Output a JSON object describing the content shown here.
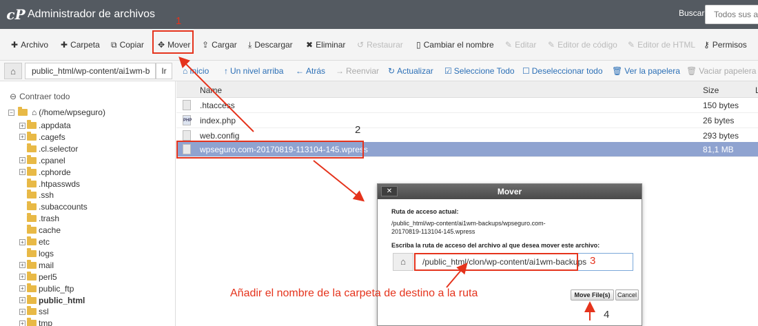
{
  "header": {
    "logo": "cP",
    "title": "Administrador de archivos",
    "search_label": "Buscar",
    "search_placeholder": "Todos sus archivos"
  },
  "toolbar": {
    "archivo": "Archivo",
    "carpeta": "Carpeta",
    "copiar": "Copiar",
    "mover": "Mover",
    "cargar": "Cargar",
    "descargar": "Descargar",
    "eliminar": "Eliminar",
    "restaurar": "Restaurar",
    "cambiar_nombre": "Cambiar el nombre",
    "editar": "Editar",
    "editor_codigo": "Editor de código",
    "editor_html": "Editor de HTML",
    "permisos": "Permisos"
  },
  "pathbar": {
    "path": "public_html/wp-content/ai1wm-b",
    "go": "Ir",
    "inicio": "Inicio",
    "up": "Un nivel arriba",
    "back": "Atrás",
    "forward": "Reenviar",
    "refresh": "Actualizar",
    "select_all": "Seleccione Todo",
    "deselect_all": "Deseleccionar todo",
    "trash": "Ver la papelera",
    "empty_trash": "Vaciar papelera"
  },
  "sidebar": {
    "collapse": "Contraer todo",
    "root": "(/home/wpseguro)",
    "items": [
      {
        "label": ".appdata"
      },
      {
        "label": ".cagefs"
      },
      {
        "label": ".cl.selector"
      },
      {
        "label": ".cpanel"
      },
      {
        "label": ".cphorde"
      },
      {
        "label": ".htpasswds"
      },
      {
        "label": ".ssh"
      },
      {
        "label": ".subaccounts"
      },
      {
        "label": ".trash"
      },
      {
        "label": "cache"
      },
      {
        "label": "etc"
      },
      {
        "label": "logs"
      },
      {
        "label": "mail"
      },
      {
        "label": "perl5"
      },
      {
        "label": "public_ftp"
      },
      {
        "label": "public_html"
      },
      {
        "label": "ssl"
      },
      {
        "label": "tmp"
      }
    ]
  },
  "filelist": {
    "col_name": "Name",
    "col_size": "Size",
    "col_extra": "L",
    "rows": [
      {
        "name": ".htaccess",
        "size": "150 bytes"
      },
      {
        "name": "index.php",
        "size": "26 bytes"
      },
      {
        "name": "web.config",
        "size": "293 bytes"
      },
      {
        "name": "wpseguro.com-20170819-113104-145.wpress",
        "size": "81,1 MB"
      }
    ]
  },
  "dialog": {
    "title": "Mover",
    "close": "✕",
    "current_label": "Ruta de acceso actual:",
    "current_path": "/public_html/wp-content/ai1wm-backups/wpseguro.com-20170819-113104-145.wpress",
    "target_label": "Escriba la ruta de acceso del archivo al que desea mover este archivo:",
    "target_value": "/public_html/clon/wp-content/ai1wm-backups",
    "move_button": "Move File(s)",
    "cancel_button": "Cancel"
  },
  "annotations": {
    "n1": "1",
    "n2": "2",
    "n3": "3",
    "n4": "4",
    "text": "Añadir el nombre de la carpeta de destino a la ruta",
    "color": "#e5331c"
  }
}
